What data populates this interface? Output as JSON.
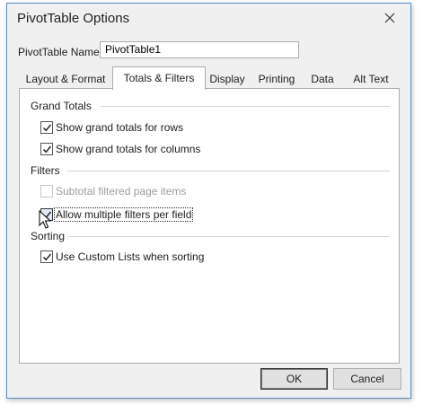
{
  "dialog": {
    "title": "PivotTable Options"
  },
  "name_field": {
    "label": "PivotTable Name:",
    "value": "PivotTable1"
  },
  "tabs": [
    {
      "label": "Layout & Format",
      "active": false
    },
    {
      "label": "Totals & Filters",
      "active": true
    },
    {
      "label": "Display",
      "active": false
    },
    {
      "label": "Printing",
      "active": false
    },
    {
      "label": "Data",
      "active": false
    },
    {
      "label": "Alt Text",
      "active": false
    }
  ],
  "groups": {
    "grand_totals": {
      "label": "Grand Totals",
      "options": [
        {
          "label": "Show grand totals for rows",
          "checked": true,
          "enabled": true
        },
        {
          "label": "Show grand totals for columns",
          "checked": true,
          "enabled": true
        }
      ]
    },
    "filters": {
      "label": "Filters",
      "options": [
        {
          "label": "Subtotal filtered page items",
          "checked": false,
          "enabled": false
        },
        {
          "label": "Allow multiple filters per field",
          "checked": true,
          "enabled": true
        }
      ]
    },
    "sorting": {
      "label": "Sorting",
      "options": [
        {
          "label": "Use Custom Lists when sorting",
          "checked": true,
          "enabled": true
        }
      ]
    }
  },
  "buttons": {
    "ok": "OK",
    "cancel": "Cancel"
  },
  "icons": {
    "close": "close-icon",
    "check": "checkmark-icon",
    "cursor": "mouse-pointer-icon"
  }
}
